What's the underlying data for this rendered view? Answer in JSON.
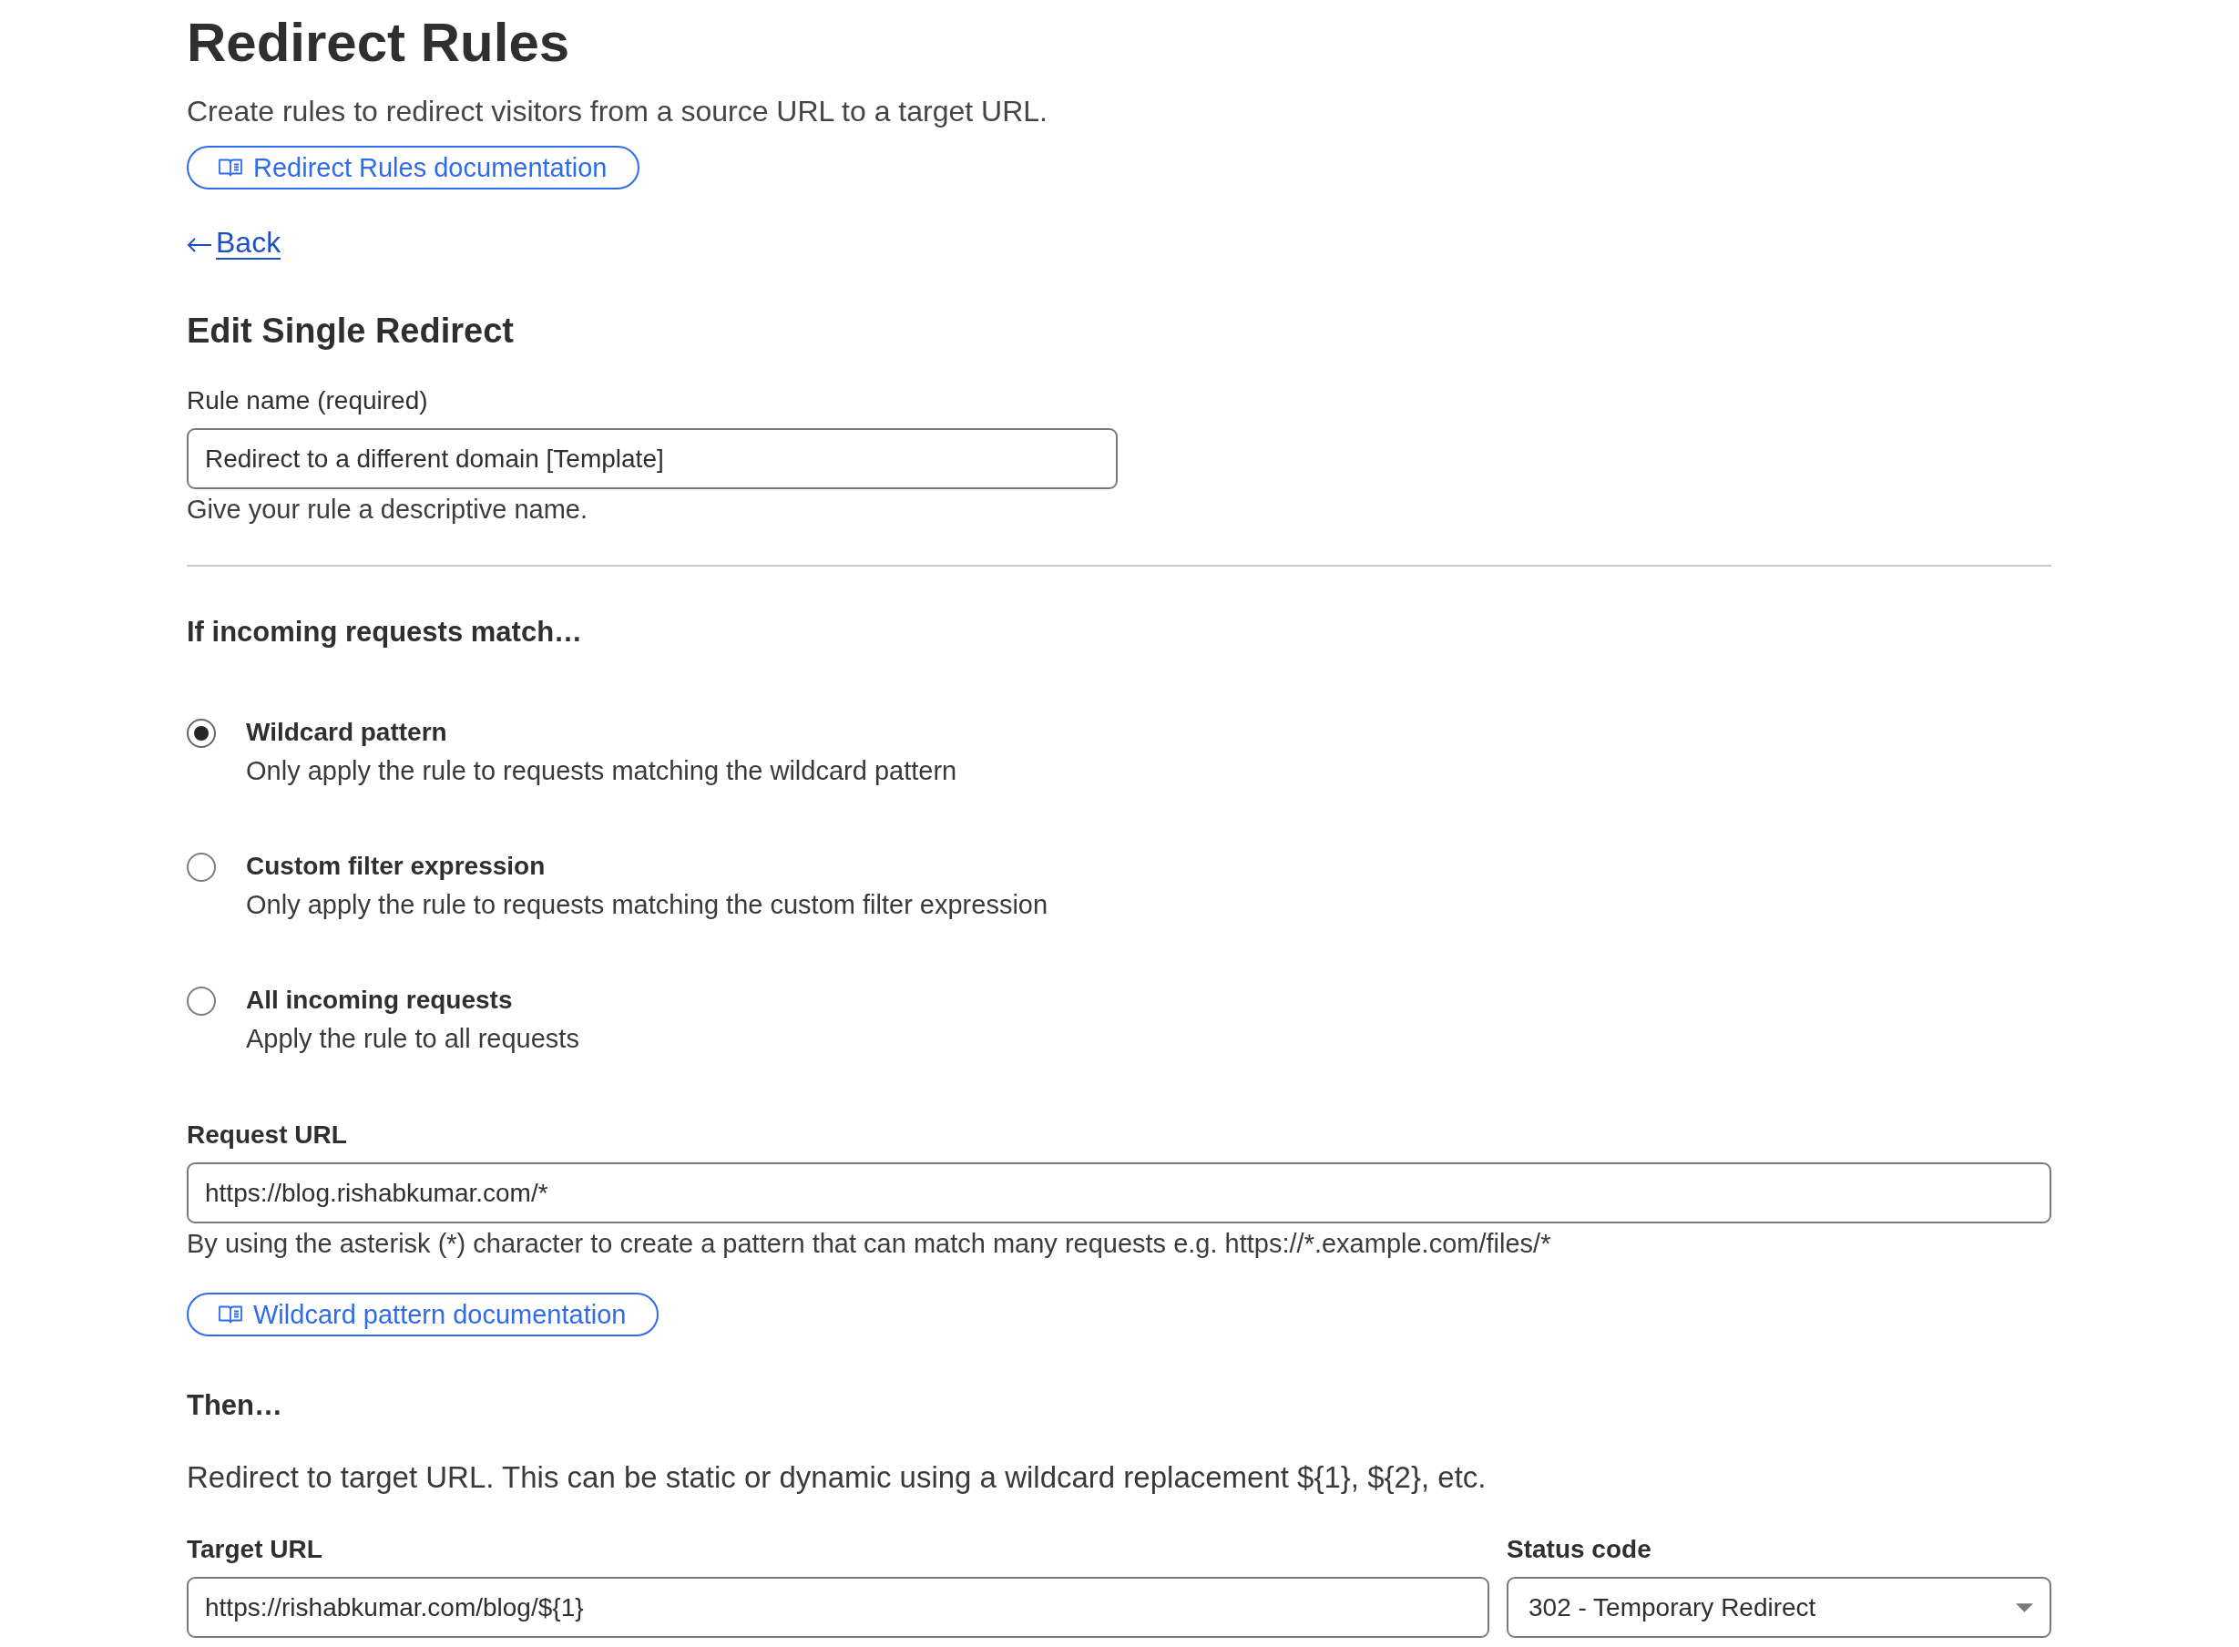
{
  "page": {
    "title": "Redirect Rules",
    "subtitle": "Create rules to redirect visitors from a source URL to a target URL.",
    "doc_link": {
      "label": "Redirect Rules documentation"
    }
  },
  "back_link": {
    "label": "Back"
  },
  "form": {
    "title": "Edit Single Redirect",
    "rule_name": {
      "label": "Rule name (required)",
      "value": "Redirect to a different domain [Template]",
      "hint": "Give your rule a descriptive name."
    },
    "match": {
      "heading": "If incoming requests match…",
      "options": [
        {
          "label": "Wildcard pattern",
          "description": "Only apply the rule to requests matching the wildcard pattern",
          "selected": true
        },
        {
          "label": "Custom filter expression",
          "description": "Only apply the rule to requests matching the custom filter expression",
          "selected": false
        },
        {
          "label": "All incoming requests",
          "description": "Apply the rule to all requests",
          "selected": false
        }
      ]
    },
    "request_url": {
      "label": "Request URL",
      "value": "https://blog.rishabkumar.com/*",
      "hint": "By using the asterisk (*) character to create a pattern that can match many requests e.g. https://*.example.com/files/*",
      "doc_link": {
        "label": "Wildcard pattern documentation"
      }
    },
    "then": {
      "heading": "Then…",
      "description": "Redirect to target URL. This can be static or dynamic using a wildcard replacement ${1}, ${2}, etc.",
      "target_url": {
        "label": "Target URL",
        "value": "https://rishabkumar.com/blog/${1}"
      },
      "status_code": {
        "label": "Status code",
        "value": "302 - Temporary Redirect"
      }
    }
  }
}
